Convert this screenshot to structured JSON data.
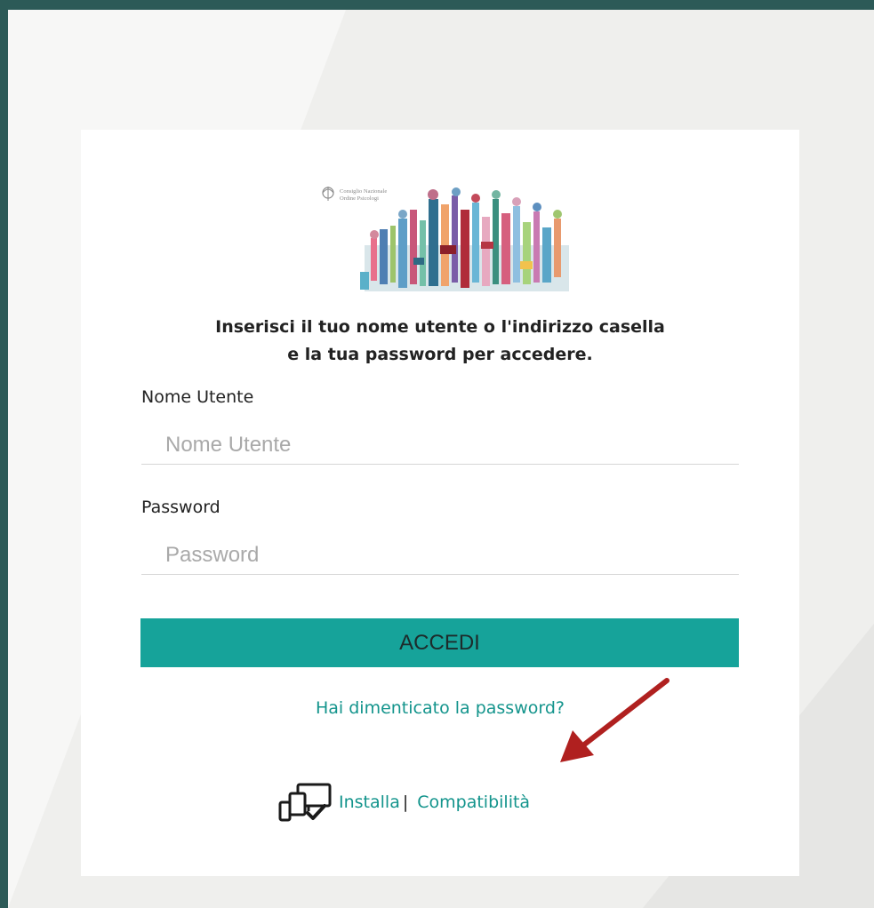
{
  "logo": {
    "line1": "Consiglio Nazionale",
    "line2": "Ordine Psicologi"
  },
  "login": {
    "instructions_line1": "Inserisci il tuo nome utente o l'indirizzo casella",
    "instructions_line2": "e la tua password per accedere.",
    "username_label": "Nome Utente",
    "username_placeholder": "Nome Utente",
    "password_label": "Password",
    "password_placeholder": "Password",
    "submit_label": "ACCEDI",
    "forgot_label": "Hai dimenticato la password?"
  },
  "footer": {
    "install_label": "Installa",
    "separator": "|",
    "compat_label": "Compatibilità"
  },
  "colors": {
    "accent": "#16a39a",
    "link": "#13948c",
    "annotation_arrow": "#b0201f",
    "border": "#2c5a57"
  },
  "icons": {
    "devices": "devices-check-icon",
    "annotation": "red-arrow-annotation"
  }
}
